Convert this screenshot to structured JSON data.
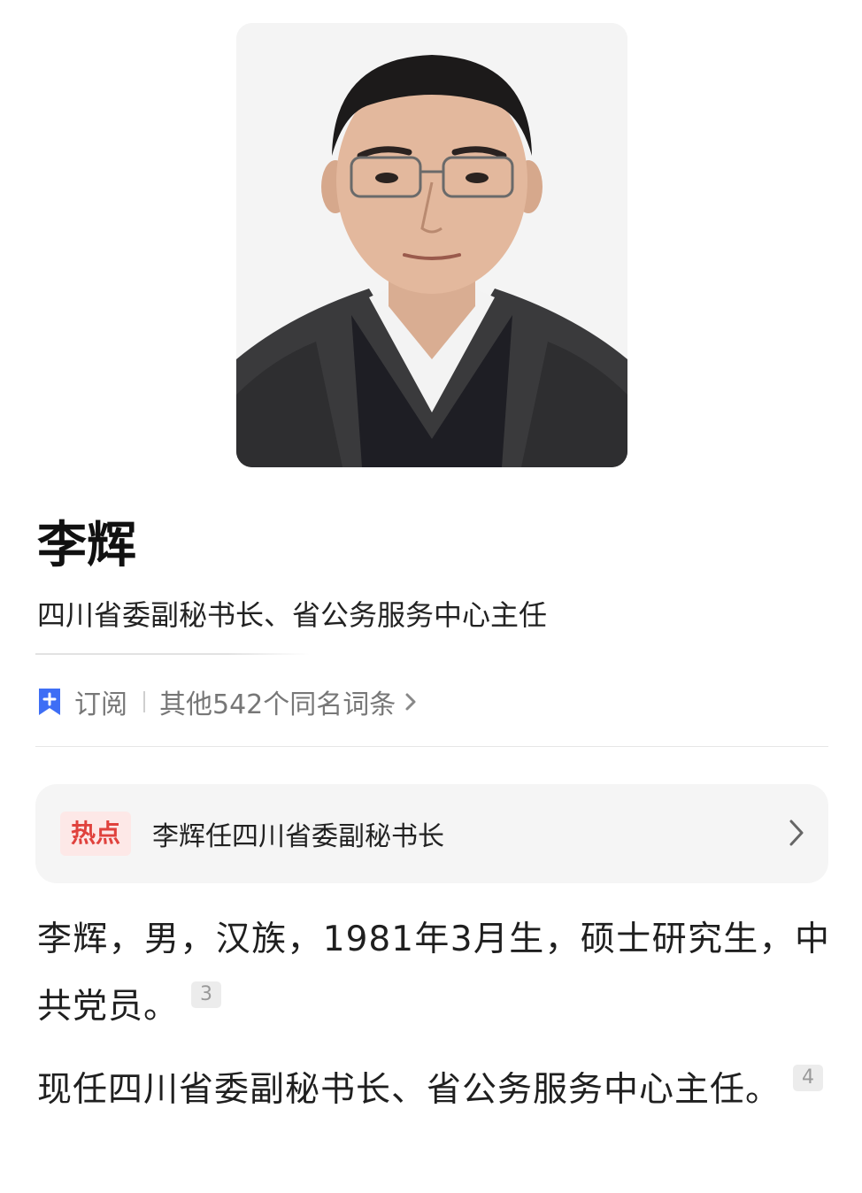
{
  "profile": {
    "name": "李辉",
    "subtitle": "四川省委副秘书长、省公务服务中心主任"
  },
  "actions": {
    "subscribe_label": "订阅",
    "homonyms_label": "其他542个同名词条"
  },
  "hot": {
    "badge": "热点",
    "text": "李辉任四川省委副秘书长"
  },
  "body": {
    "para1": "李辉，男，汉族，1981年3月生，硕士研究生，中共党员。",
    "para1_cite": "3",
    "para2": "现任四川省委副秘书长、省公务服务中心主任。",
    "para2_cite": "4"
  },
  "colors": {
    "hot_badge_text": "#e0423d",
    "hot_badge_bg": "#fde8e7",
    "bookmark_icon": "#3e6ef5"
  },
  "icons": {
    "subscribe": "bookmark-plus-icon",
    "homonyms_chevron": "chevron-right-icon",
    "hot_chevron": "chevron-right-icon"
  }
}
